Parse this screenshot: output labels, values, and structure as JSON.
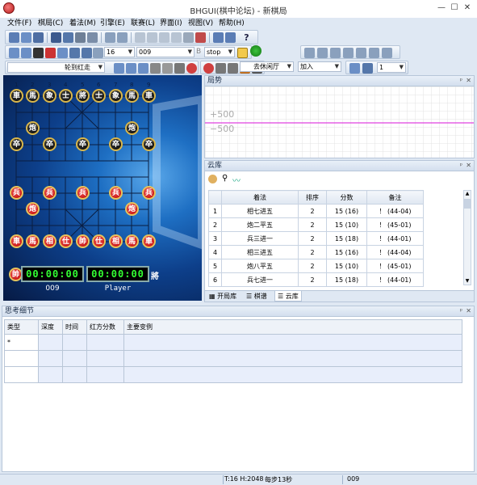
{
  "window": {
    "title": "BHGUI(棋中论坛) - 新棋局"
  },
  "menu": [
    "文件(F)",
    "棋局(C)",
    "着法(M)",
    "引擎(E)",
    "联赛(L)",
    "界面(I)",
    "视图(V)",
    "帮助(H)"
  ],
  "toolbar": {
    "depth_value": "16",
    "engine_value": "009",
    "stop_value": "stop",
    "turn_value": "轮到红走",
    "opening_value": "去休闲厅",
    "join_value": "加入",
    "slot_value": "1"
  },
  "board": {
    "black_back": [
      "車",
      "馬",
      "象",
      "士",
      "將",
      "士",
      "象",
      "馬",
      "車"
    ],
    "black_cannon": "炮",
    "black_pawn": "卒",
    "red_pawn": "兵",
    "red_cannon": "炮",
    "red_back": [
      "車",
      "馬",
      "相",
      "仕",
      "帥",
      "仕",
      "相",
      "馬",
      "車"
    ],
    "red_label": "帥",
    "black_label": "將",
    "red_clock": "00:00:00",
    "black_clock": "00:00:00",
    "red_player": "009",
    "black_player": "Player"
  },
  "trend_panel": {
    "title": "局势",
    "pos_label": "+500",
    "neg_label": "−500"
  },
  "cloud_panel": {
    "title": "云库",
    "columns": [
      "着法",
      "排序",
      "分数",
      "备注"
    ],
    "rows": [
      {
        "n": "1",
        "move": "相七进五",
        "rank": "2",
        "score": "15  (16)",
        "note": "！ (44-04)"
      },
      {
        "n": "2",
        "move": "炮二平五",
        "rank": "2",
        "score": "15  (10)",
        "note": "！ (45-01)"
      },
      {
        "n": "3",
        "move": "兵三进一",
        "rank": "2",
        "score": "15  (18)",
        "note": "！ (44-01)"
      },
      {
        "n": "4",
        "move": "相三进五",
        "rank": "2",
        "score": "15  (16)",
        "note": "！ (44-04)"
      },
      {
        "n": "5",
        "move": "炮八平五",
        "rank": "2",
        "score": "15  (10)",
        "note": "！ (45-01)"
      },
      {
        "n": "6",
        "move": "兵七进一",
        "rank": "2",
        "score": "15  (18)",
        "note": "！ (44-01)"
      }
    ],
    "tabs": [
      "开局库",
      "棋谱",
      "云库"
    ]
  },
  "thinking_panel": {
    "title": "思考细节",
    "columns": [
      "类型",
      "深度",
      "时间",
      "红方分数",
      "主要变例"
    ],
    "first_cell": "*"
  },
  "status": {
    "hash": "T:16 H:2048",
    "time": "每步13秒",
    "engine": "009"
  },
  "colors": {
    "accent": "#1e6fc3",
    "trend_line": "#e040e0",
    "piece_red": "#c00000",
    "piece_black": "#111111"
  }
}
